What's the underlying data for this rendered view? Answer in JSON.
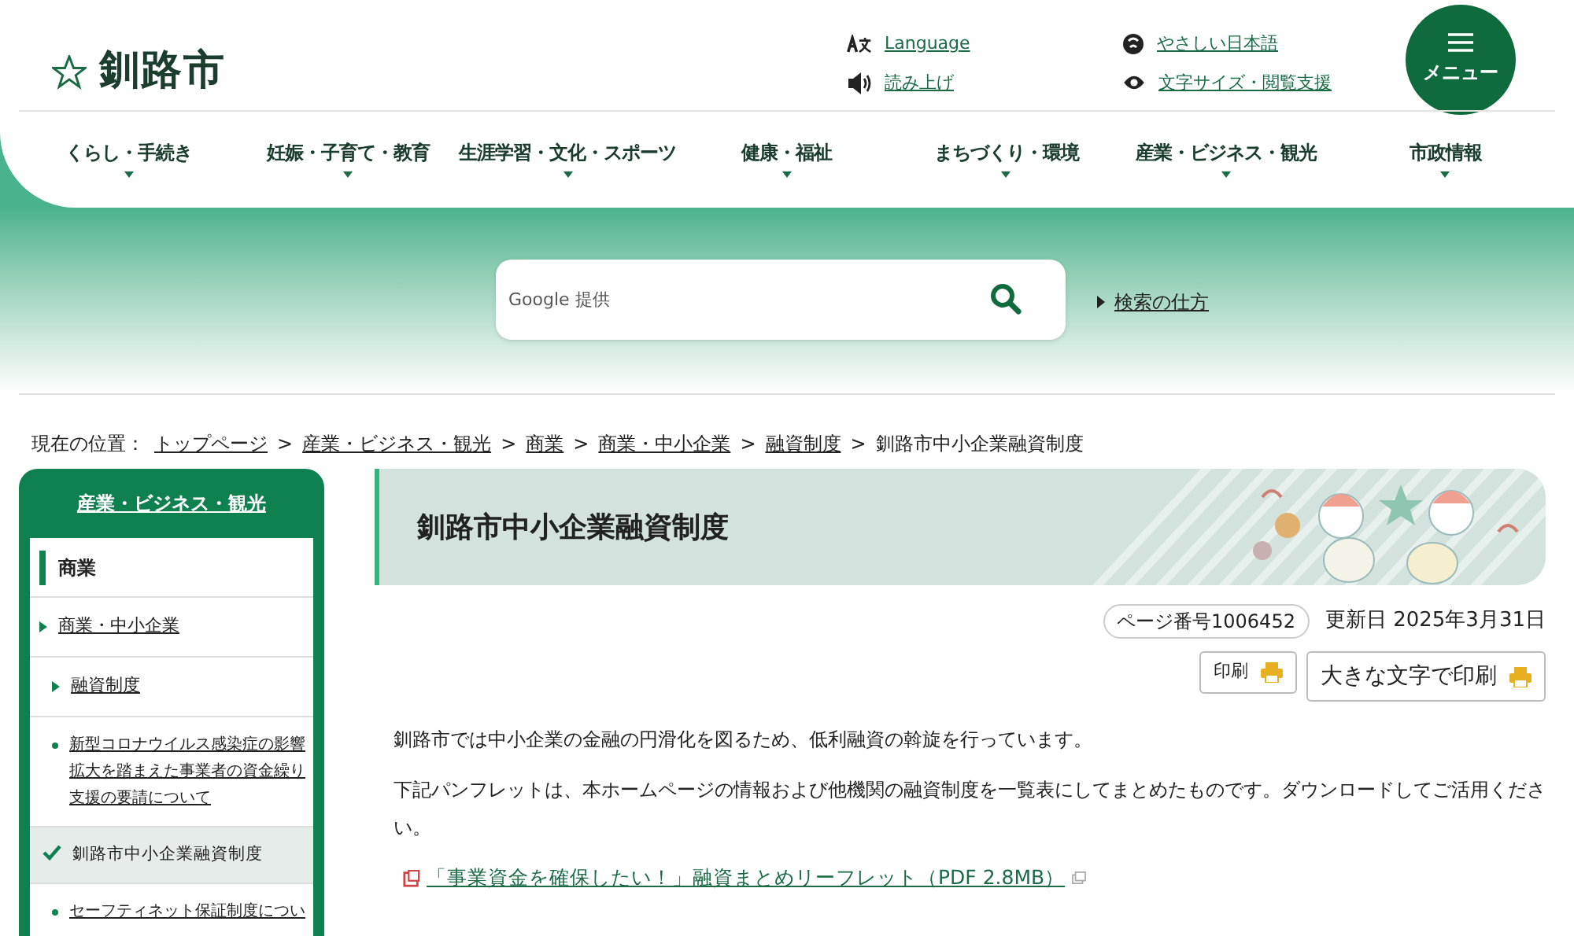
{
  "header": {
    "logo": "釧路市",
    "links": [
      {
        "kind": "language",
        "label": "Language"
      },
      {
        "kind": "easy",
        "label": "やさしい日本語"
      },
      {
        "kind": "speaker",
        "label": "読み上げ"
      },
      {
        "kind": "eye",
        "label": "文字サイズ・閲覧支援"
      }
    ],
    "menu_button": "メニュー"
  },
  "nav": [
    "くらし・手続き",
    "妊娠・子育て・教育",
    "生涯学習・文化・スポーツ",
    "健康・福祉",
    "まちづくり・環境",
    "産業・ビジネス・観光",
    "市政情報"
  ],
  "search": {
    "placeholder": "Google 提供",
    "help_link": "検索の仕方"
  },
  "breadcrumb": {
    "label": "現在の位置：",
    "items": [
      "トップページ",
      "産業・ビジネス・観光",
      "商業",
      "商業・中小企業",
      "融資制度"
    ],
    "separators": [
      ">",
      ">",
      ">",
      ">",
      ">"
    ],
    "current": "釧路市中小企業融資制度"
  },
  "sidebar": {
    "title": "産業・ビジネス・観光",
    "items": [
      {
        "label": "商業",
        "children": [
          {
            "label": "商業・中小企業",
            "children": [
              {
                "label": "融資制度",
                "children": [
                  {
                    "label": "新型コロナウイルス感染症の影響拡大を踏まえた事業者の資金繰り支援の要請について",
                    "selected": false
                  },
                  {
                    "label": "釧路市中小企業融資制度",
                    "selected": true
                  },
                  {
                    "label": "セーフティネット保証制度につい",
                    "selected": false
                  }
                ]
              }
            ]
          }
        ]
      }
    ]
  },
  "page": {
    "title": "釧路市中小企業融資制度",
    "page_number": "ページ番号1006452",
    "updated": "更新日 2025年3月31日",
    "buttons": [
      "印刷",
      "大きな文字で印刷"
    ],
    "paragraphs": [
      "釧路市では中小企業の金融の円滑化を図るため、低利融資の斡旋を行っています。",
      "下記パンフレットは、本ホームページの情報および他機関の融資制度を一覧表にしてまとめたものです。ダウンロードしてご活用ください。"
    ],
    "file_link": "「事業資金を確保したい！」融資まとめリーフレット（PDF 2.8MB）"
  }
}
